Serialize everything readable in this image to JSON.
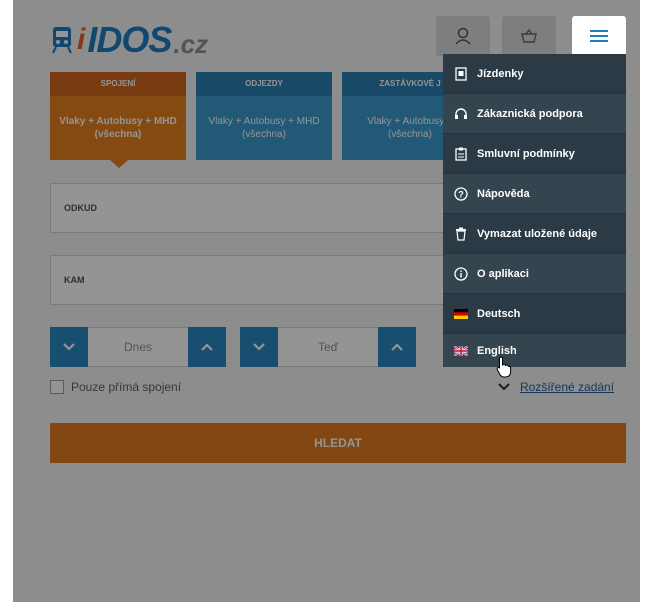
{
  "header": {
    "brand": "IDOS",
    "brand_tld": ".cz",
    "icons": {
      "user": "user-icon",
      "basket": "basket-icon",
      "menu": "hamburger-menu-icon"
    }
  },
  "tabs": [
    {
      "title": "SPOJENÍ",
      "subtitle": "Vlaky + Autobusy + MHD (všechna)",
      "active": true
    },
    {
      "title": "ODJEZDY",
      "subtitle": "Vlaky + Autobusy + MHD (všechna)",
      "active": false
    },
    {
      "title": "ZASTÁVKOVÉ J",
      "subtitle": "Vlaky + Autobusy + (všechna)",
      "active": false
    }
  ],
  "form": {
    "from_label": "ODKUD",
    "to_label": "KAM",
    "date_value": "Dnes",
    "time_value": "Teď",
    "direct_only_label": "Pouze přímá spojení",
    "advanced_label": "Rozšířené zadání",
    "search_label": "HLEDAT"
  },
  "menu": {
    "items": [
      {
        "label": "Jízdenky",
        "icon": "ticket-icon"
      },
      {
        "label": "Zákaznická podpora",
        "icon": "headset-icon"
      },
      {
        "label": "Smluvní podmínky",
        "icon": "clipboard-icon"
      },
      {
        "label": "Nápověda",
        "icon": "help-icon"
      },
      {
        "label": "Vymazat uložené údaje",
        "icon": "trash-icon"
      },
      {
        "label": "O aplikaci",
        "icon": "info-icon"
      },
      {
        "label": "Deutsch",
        "icon": "german-flag-icon"
      },
      {
        "label": "English",
        "icon": "uk-flag-icon"
      }
    ]
  },
  "colors": {
    "brand_blue": "#1f7bbf",
    "accent_orange": "#e07a20",
    "tab_blue": "#3b99cc",
    "menu_bg": "#2b3a44"
  }
}
